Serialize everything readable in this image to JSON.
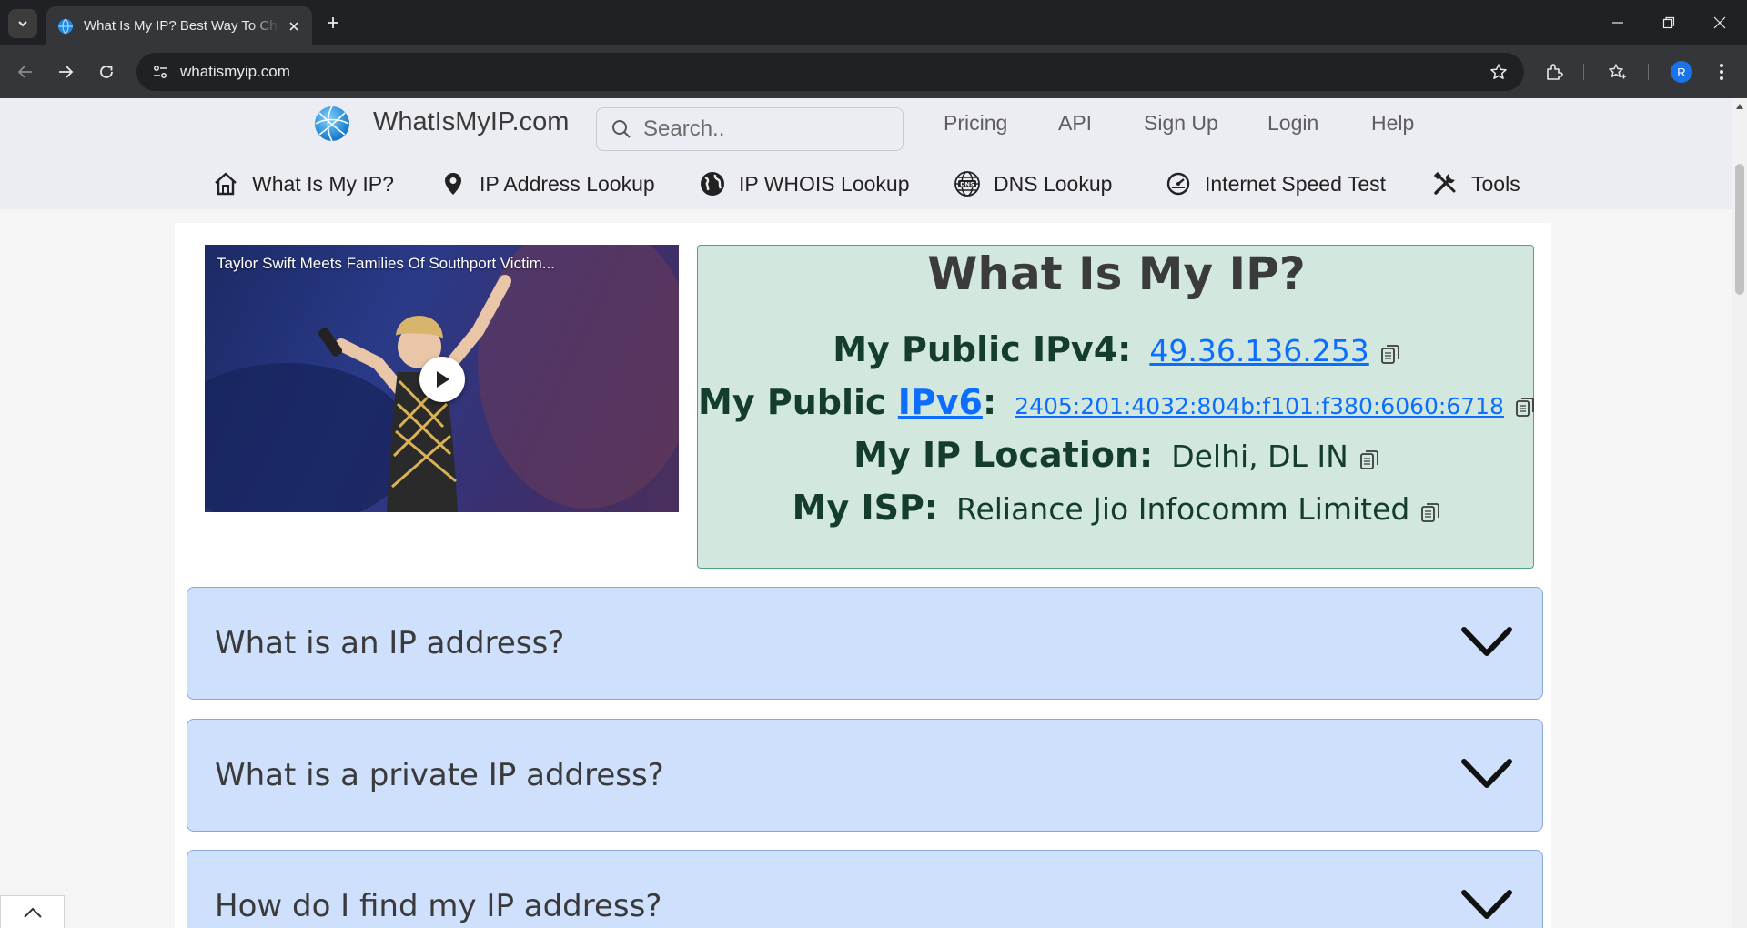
{
  "browser": {
    "tab_title": "What Is My IP? Best Way To Check Your IP Address",
    "url": "whatismyip.com",
    "profile_initial": "R"
  },
  "site": {
    "brand": "WhatIsMyIP.com",
    "search_placeholder": "Search..",
    "top_links": [
      "Pricing",
      "API",
      "Sign Up",
      "Login",
      "Help"
    ],
    "nav": [
      {
        "label": "What Is My IP?",
        "icon": "home-icon"
      },
      {
        "label": "IP Address Lookup",
        "icon": "map-pin-icon"
      },
      {
        "label": "IP WHOIS Lookup",
        "icon": "globe-icon"
      },
      {
        "label": "DNS Lookup",
        "icon": "dns-globe-icon"
      },
      {
        "label": "Internet Speed Test",
        "icon": "speedometer-icon"
      },
      {
        "label": "Tools",
        "icon": "tools-icon"
      }
    ]
  },
  "video": {
    "title": "Taylor Swift Meets Families Of Southport Victim..."
  },
  "ip_card": {
    "heading": "What Is My IP?",
    "ipv4_label": "My Public IPv4:",
    "ipv4_value": "49.36.136.253",
    "ipv6_label_prefix": "My Public",
    "ipv6_label_link": "IPv6",
    "ipv6_label_suffix": ":",
    "ipv6_value": "2405:201:4032:804b:f101:f380:6060:6718",
    "location_label": "My IP Location:",
    "location_value": "Delhi, DL IN",
    "isp_label": "My ISP:",
    "isp_value": "Reliance Jio Infocomm Limited"
  },
  "faq": [
    "What is an IP address?",
    "What is a private IP address?",
    "How do I find my IP address?"
  ],
  "colors": {
    "ip_card_bg": "#d2e8df",
    "ip_card_border": "#4ea57c",
    "faq_bg": "#cfe0fd",
    "link": "#0d6efd"
  }
}
